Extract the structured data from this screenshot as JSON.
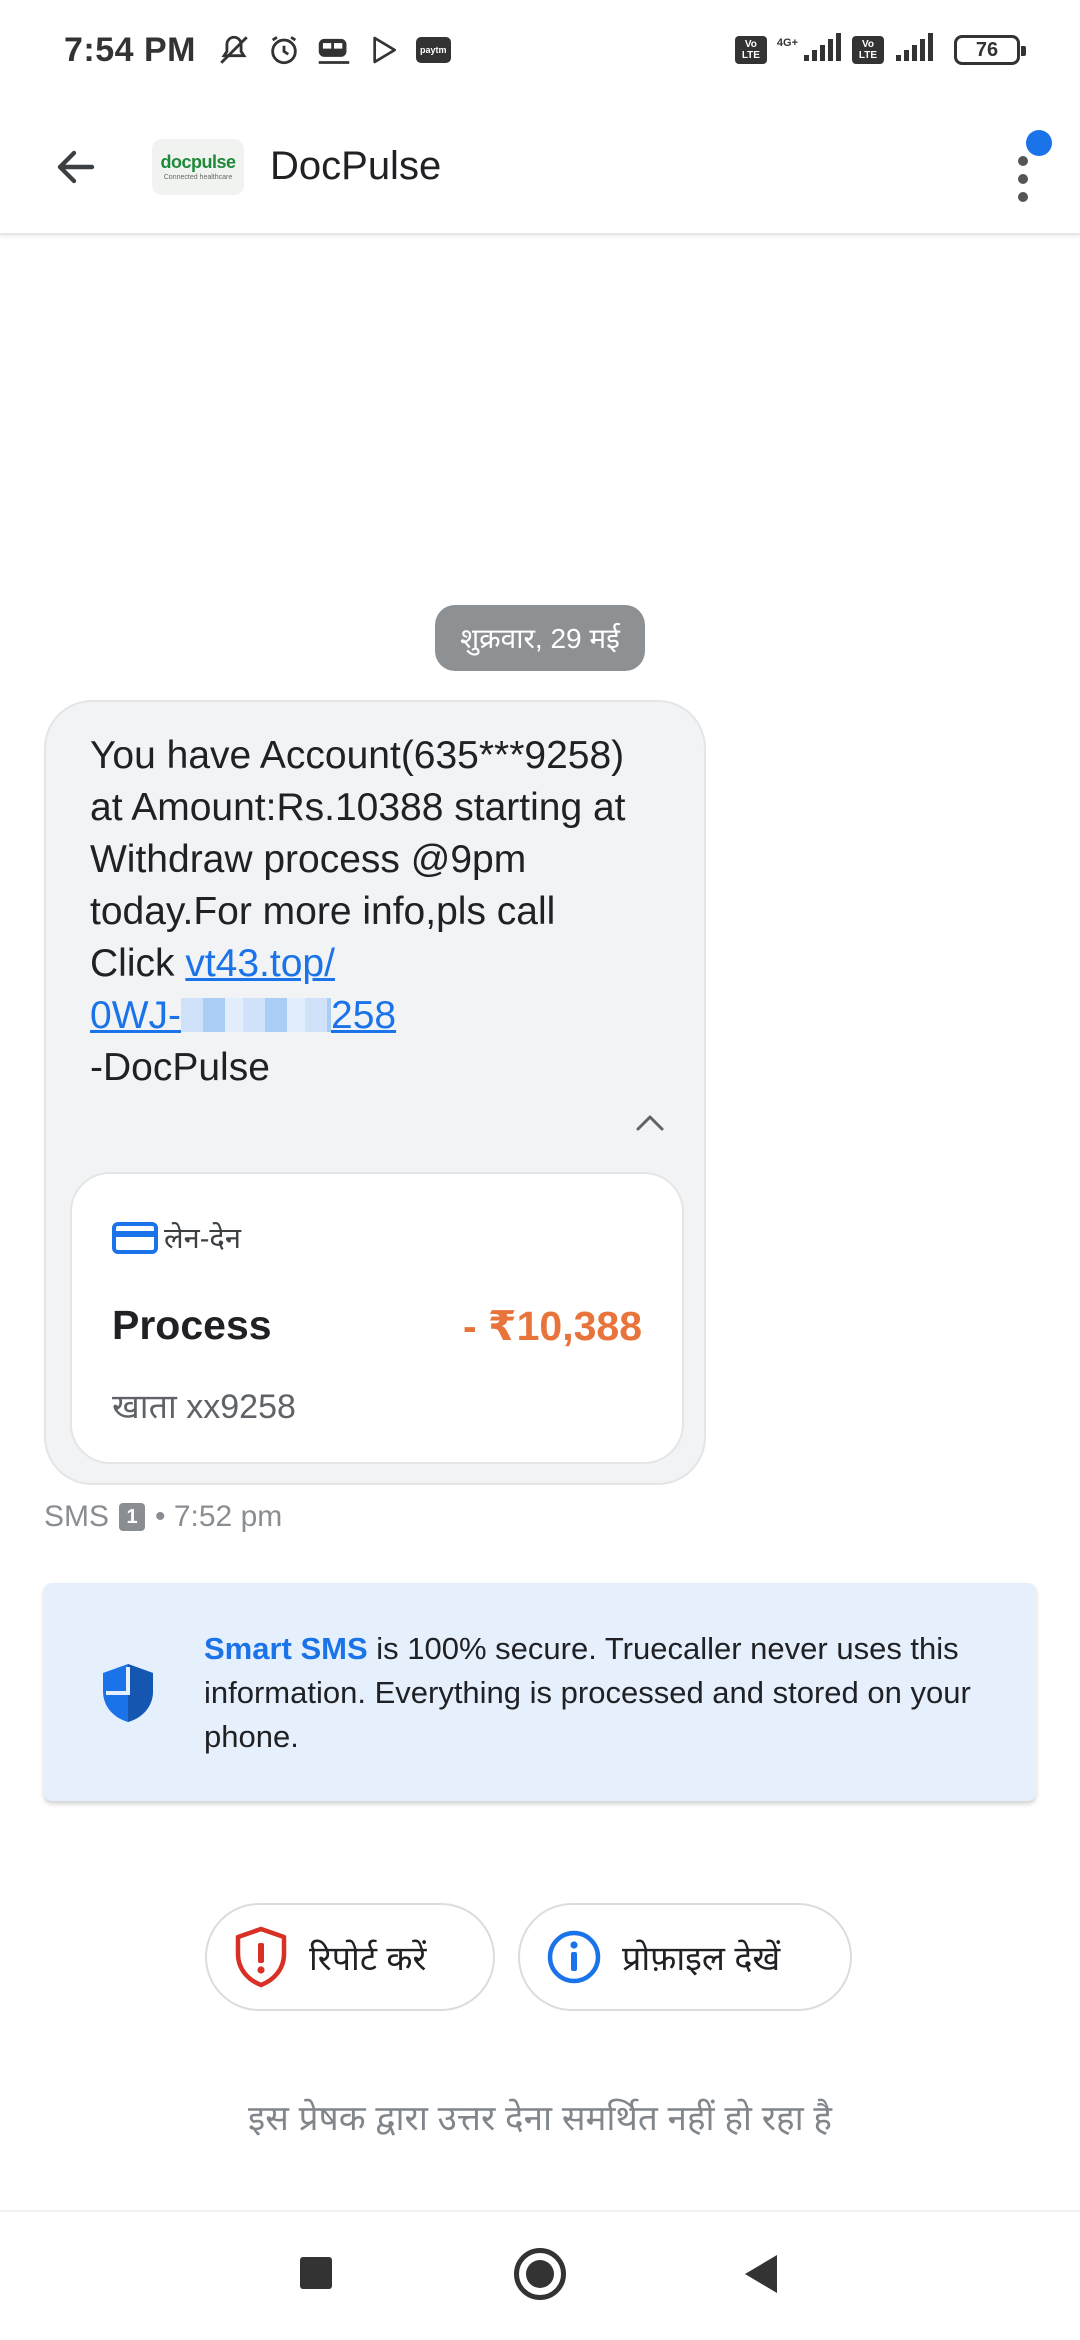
{
  "status_bar": {
    "time": "7:54 PM",
    "icons_left": [
      "mute-icon",
      "alarm-icon",
      "train-icon",
      "play-store-icon",
      "paytm-icon"
    ],
    "paytm_label": "paytm",
    "volte_label": "Vo LTE",
    "network_type": "4G+",
    "battery_level": "76"
  },
  "app_bar": {
    "title": "DocPulse",
    "logo_text": "docpulse",
    "logo_subtext": "Connected healthcare"
  },
  "conversation": {
    "date_chip": "शुक्रवार, 29 मई",
    "message": {
      "text_before_link": "You have Account(635***9258) at Amount:Rs.10388 starting at Withdraw process @9pm today.For more info,pls call Click ",
      "link_prefix": "vt43.top/",
      "link_start": "0WJ-",
      "link_end": "258",
      "signature": "-DocPulse"
    },
    "transaction_card": {
      "label": "लेन-देन",
      "title": "Process",
      "amount": "- ₹10,388",
      "account": "खाता xx9258",
      "amount_color": "#e8743b"
    },
    "meta": {
      "channel": "SMS",
      "sim": "1",
      "time": "• 7:52 pm"
    }
  },
  "info_banner": {
    "highlight": "Smart SMS",
    "text": " is 100% secure. Truecaller never uses this information. Everything is processed and stored on your phone."
  },
  "actions": {
    "report_label": "रिपोर्ट करें",
    "profile_label": "प्रोफ़ाइल देखें"
  },
  "footer_note": "इस प्रेषक द्वारा उत्तर देना समर्थित नहीं हो रहा है",
  "colors": {
    "accent": "#1a73e8",
    "danger": "#d93025",
    "amount": "#e8743b"
  }
}
